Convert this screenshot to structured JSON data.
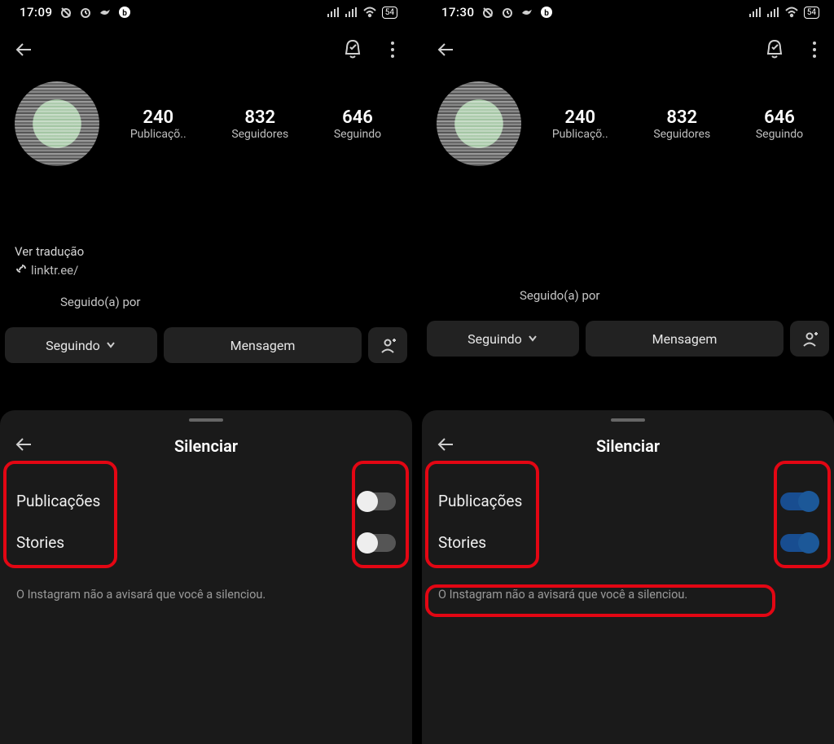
{
  "left": {
    "status": {
      "time": "17:09",
      "battery": "54"
    },
    "stats": {
      "posts_num": "240",
      "posts_lbl": "Publicaçõ..",
      "followers_num": "832",
      "followers_lbl": "Seguidores",
      "following_num": "646",
      "following_lbl": "Seguindo"
    },
    "translate": "Ver tradução",
    "link_text": "linktr.ee/",
    "followed_by": "Seguido(a) por",
    "btn_following": "Seguindo",
    "btn_message": "Mensagem",
    "sheet": {
      "title": "Silenciar",
      "row_posts": "Publicações",
      "row_stories": "Stories",
      "note": "O Instagram não a avisará que você a silenciou.",
      "posts_on": false,
      "stories_on": false
    }
  },
  "right": {
    "status": {
      "time": "17:30",
      "battery": "54"
    },
    "stats": {
      "posts_num": "240",
      "posts_lbl": "Publicaçõ..",
      "followers_num": "832",
      "followers_lbl": "Seguidores",
      "following_num": "646",
      "following_lbl": "Seguindo"
    },
    "followed_by": "Seguido(a) por",
    "btn_following": "Seguindo",
    "btn_message": "Mensagem",
    "sheet": {
      "title": "Silenciar",
      "row_posts": "Publicações",
      "row_stories": "Stories",
      "note": "O Instagram não a avisará que você a silenciou.",
      "posts_on": true,
      "stories_on": true
    }
  }
}
